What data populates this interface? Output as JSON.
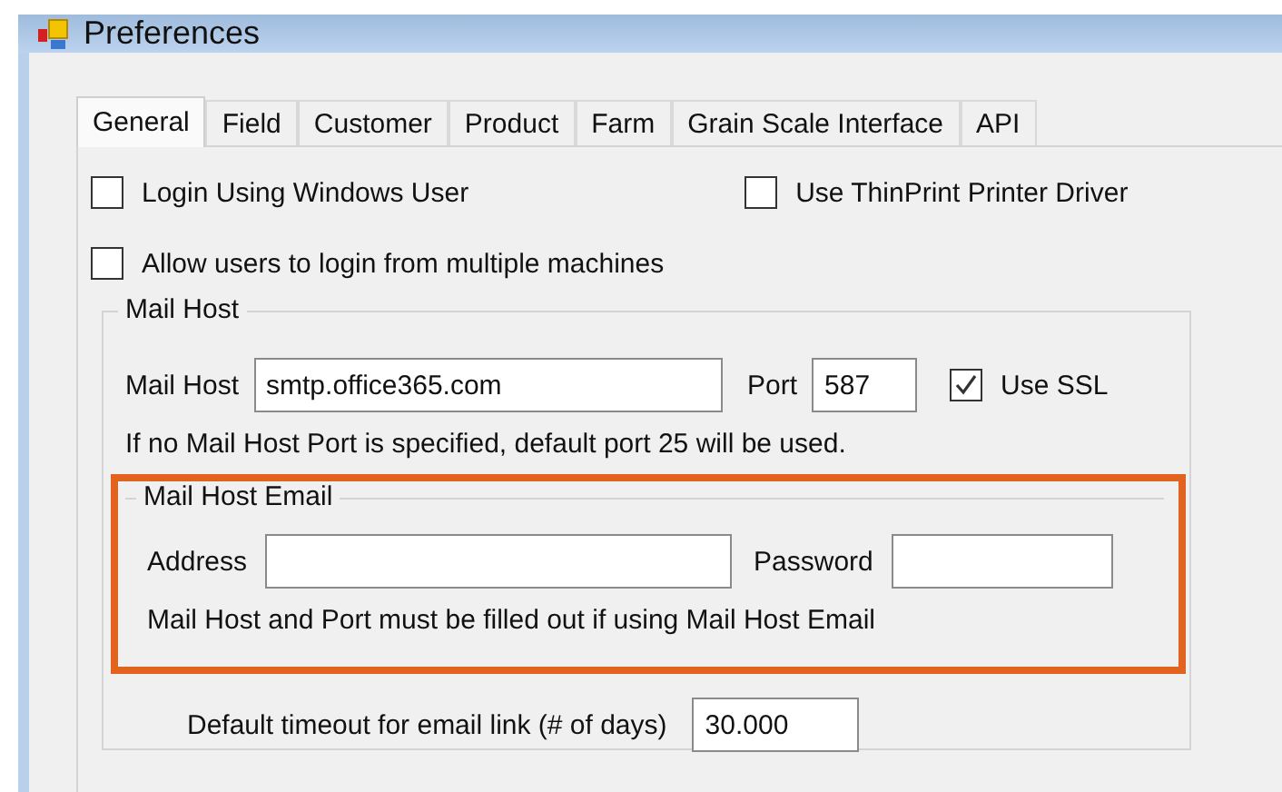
{
  "window": {
    "title": "Preferences"
  },
  "tabs": [
    {
      "label": "General",
      "selected": true
    },
    {
      "label": "Field",
      "selected": false
    },
    {
      "label": "Customer",
      "selected": false
    },
    {
      "label": "Product",
      "selected": false
    },
    {
      "label": "Farm",
      "selected": false
    },
    {
      "label": "Grain Scale Interface",
      "selected": false
    },
    {
      "label": "API",
      "selected": false
    }
  ],
  "options": [
    {
      "label": "Login Using Windows User",
      "checked": false
    },
    {
      "label": "Use ThinPrint Printer Driver",
      "checked": false
    },
    {
      "label": "Allow users to login from multiple machines",
      "checked": false
    }
  ],
  "mail_host": {
    "title": "Mail Host",
    "host_label": "Mail Host",
    "host_value": "smtp.office365.com",
    "port_label": "Port",
    "port_value": "587",
    "use_ssl": {
      "label": "Use SSL",
      "checked": true
    },
    "note": "If no Mail Host Port is specified, default port 25 will be used.",
    "email": {
      "title": "Mail Host Email",
      "highlighted": true,
      "address_label": "Address",
      "password_label": "Password",
      "note": "Mail Host and Port must be filled out if using Mail Host Email"
    },
    "timeout": {
      "label": "Default timeout for email link (# of days)",
      "value": "30.000"
    }
  }
}
